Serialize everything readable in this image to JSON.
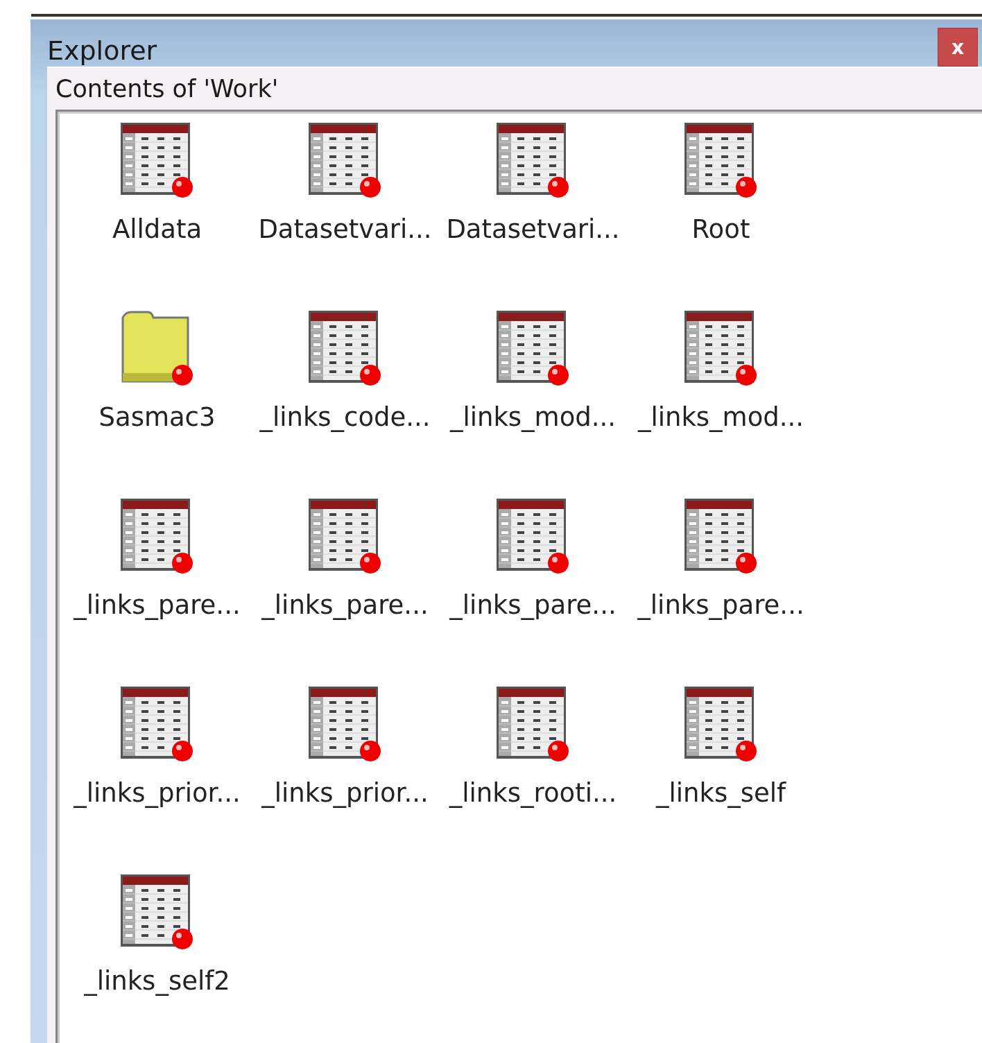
{
  "window": {
    "title": "Explorer",
    "close": "x"
  },
  "panel": {
    "title": "Contents of 'Work'"
  },
  "items": [
    {
      "label": "Alldata",
      "kind": "table"
    },
    {
      "label": "Datasetvari...",
      "kind": "table"
    },
    {
      "label": "Datasetvari...",
      "kind": "table"
    },
    {
      "label": "Root",
      "kind": "table"
    },
    {
      "label": "Sasmac3",
      "kind": "folder"
    },
    {
      "label": "_links_code...",
      "kind": "table"
    },
    {
      "label": "_links_mod...",
      "kind": "table"
    },
    {
      "label": "_links_mod...",
      "kind": "table"
    },
    {
      "label": "_links_pare...",
      "kind": "table"
    },
    {
      "label": "_links_pare...",
      "kind": "table"
    },
    {
      "label": "_links_pare...",
      "kind": "table"
    },
    {
      "label": "_links_pare...",
      "kind": "table"
    },
    {
      "label": "_links_prior...",
      "kind": "table"
    },
    {
      "label": "_links_prior...",
      "kind": "table"
    },
    {
      "label": "_links_rooti...",
      "kind": "table"
    },
    {
      "label": "_links_self",
      "kind": "table"
    },
    {
      "label": "_links_self2",
      "kind": "table"
    }
  ]
}
